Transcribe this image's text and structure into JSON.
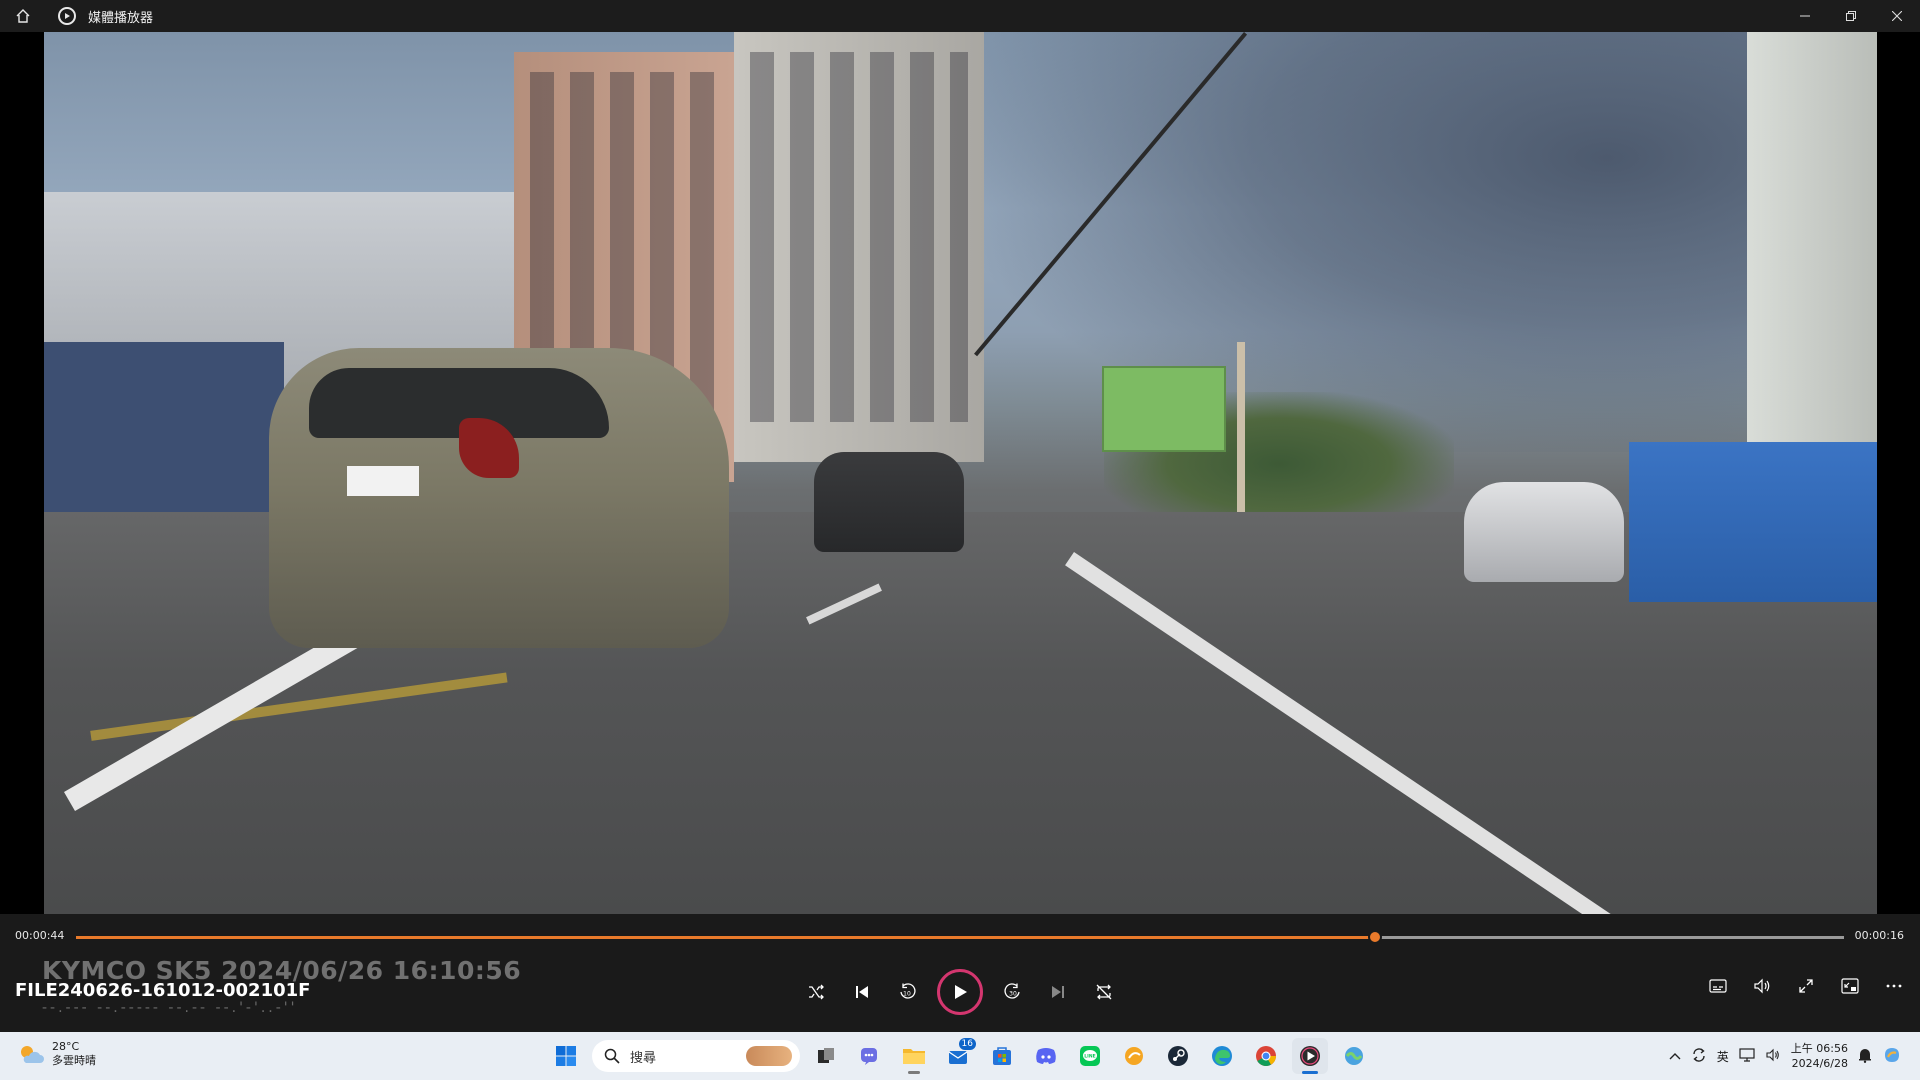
{
  "window": {
    "title": "媒體播放器",
    "icons": {
      "home": "home-icon",
      "app": "media-player-icon",
      "minimize": "minimize-icon",
      "restore": "restore-icon",
      "close": "close-icon"
    }
  },
  "player": {
    "elapsed": "00:00:44",
    "remaining": "00:00:16",
    "progress": 0.735,
    "overlay_line1": "KYMCO SK5   2024/06/26 16:10:56",
    "overlay_line2": "--.---  --.-----  --.--  --.'-'..-''",
    "file_name": "FILE240626-161012-002101F",
    "accent_color": "#e97a2b",
    "play_ring_color": "#d4366f",
    "controls": [
      "shuffle-icon",
      "previous-icon",
      "rewind-10-icon",
      "play-icon",
      "forward-30-icon",
      "next-icon",
      "repeat-off-icon"
    ],
    "right_controls": [
      "subtitles-icon",
      "volume-icon",
      "fullscreen-icon",
      "mini-player-icon",
      "more-icon"
    ]
  },
  "taskbar": {
    "weather_temp": "28°C",
    "weather_desc": "多雲時晴",
    "search_placeholder": "搜尋",
    "mail_badge": "16",
    "apps": [
      "start-icon",
      "search-icon",
      "task-view-icon",
      "teams-icon",
      "file-explorer-icon",
      "mail-icon",
      "store-icon",
      "discord-icon",
      "line-icon",
      "browser-icon",
      "steam-icon",
      "edge-icon",
      "chrome-icon",
      "media-player-icon",
      "copilot-icon"
    ],
    "tray": {
      "lang": "英",
      "time": "上午 06:56",
      "date": "2024/6/28"
    }
  }
}
